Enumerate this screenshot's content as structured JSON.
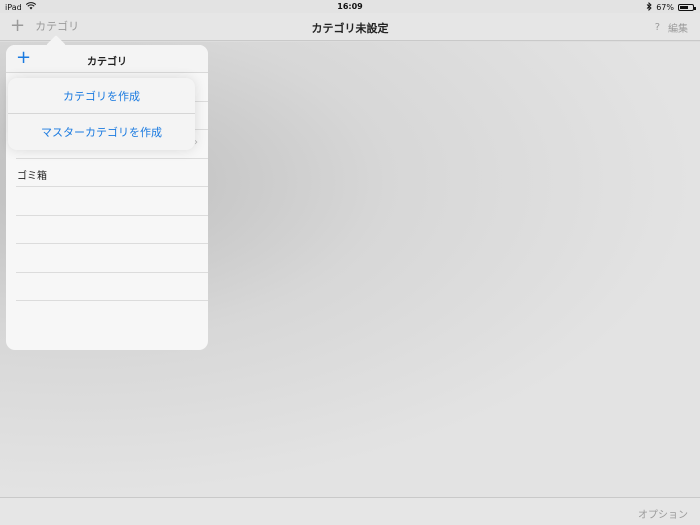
{
  "status_bar": {
    "device": "iPad",
    "time": "16:09",
    "battery_text": "67%",
    "battery_level": 0.67,
    "icons": [
      "wifi-icon",
      "bluetooth-icon",
      "battery-icon"
    ]
  },
  "nav": {
    "add_label": "+",
    "categories_label": "カテゴリ",
    "title": "カテゴリ未設定",
    "help_label": "?",
    "edit_label": "編集"
  },
  "popover": {
    "add_label": "+",
    "title": "カテゴリ",
    "rows": [
      {
        "label": "",
        "chevron": ""
      },
      {
        "label": "",
        "chevron": ""
      },
      {
        "label": "",
        "redacted": true,
        "chevron": "›"
      },
      {
        "label": "ゴミ箱",
        "chevron": ""
      },
      {
        "label": "",
        "chevron": ""
      },
      {
        "label": "",
        "chevron": ""
      },
      {
        "label": "",
        "chevron": ""
      },
      {
        "label": "",
        "chevron": ""
      }
    ]
  },
  "action_sheet": {
    "create_category": "カテゴリを作成",
    "create_master_category": "マスターカテゴリを作成"
  },
  "toolbar": {
    "options_label": "オプション"
  },
  "colors": {
    "accent": "#1a7ae0",
    "disabled": "#9a9a9a"
  }
}
